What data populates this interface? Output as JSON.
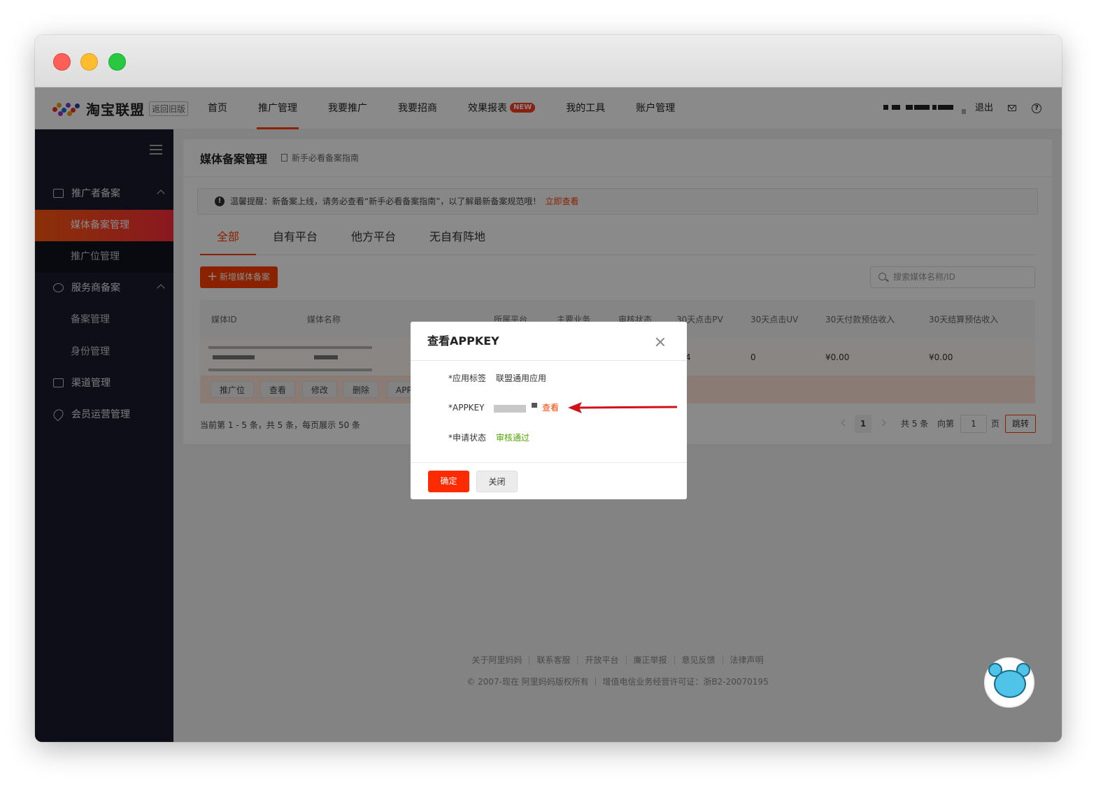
{
  "topnav": {
    "logo_text": "淘宝联盟",
    "old_version": "返回旧版",
    "items": [
      {
        "label": "首页"
      },
      {
        "label": "推广管理"
      },
      {
        "label": "我要推广"
      },
      {
        "label": "我要招商"
      },
      {
        "label": "效果报表",
        "badge": "NEW"
      },
      {
        "label": "我的工具"
      },
      {
        "label": "账户管理"
      }
    ],
    "logout": "退出",
    "help": "?"
  },
  "sidebar": {
    "groups": [
      {
        "label": "推广者备案"
      },
      {
        "label": "服务商备案"
      },
      {
        "label": "渠道管理"
      },
      {
        "label": "会员运营管理"
      }
    ],
    "items": [
      {
        "label": "媒体备案管理"
      },
      {
        "label": "推广位管理"
      },
      {
        "label": "备案管理"
      },
      {
        "label": "身份管理"
      }
    ]
  },
  "page": {
    "title": "媒体备案管理",
    "guide": "新手必看备案指南",
    "notice": "温馨提醒：新备案上线，请务必查看“新手必看备案指南”，以了解最新备案规范哦！",
    "notice_link": "立即查看",
    "notice_icon": "!",
    "tabs": [
      {
        "label": "全部"
      },
      {
        "label": "自有平台"
      },
      {
        "label": "他方平台"
      },
      {
        "label": "无自有阵地"
      }
    ],
    "add_button": "新增媒体备案",
    "add_icon": "+",
    "search_placeholder": "搜索媒体名称/ID"
  },
  "table": {
    "columns": [
      "媒体ID",
      "媒体名称",
      "所属平台",
      "主要业务",
      "审核状态",
      "30天点击PV",
      "30天点击UV",
      "30天付款预估收入",
      "30天结算预估收入"
    ],
    "row": {
      "pv": "4",
      "uv": "0",
      "pay_income": "¥0.00",
      "settle_income": "¥0.00"
    },
    "actions": [
      "推广位",
      "查看",
      "修改",
      "删除",
      "APP"
    ]
  },
  "pager": {
    "info": "当前第 1 - 5 条，共 5 条，每页展示 50 条",
    "current": "1",
    "total": "共 5 条",
    "goto_prefix": "向第",
    "goto_value": "1",
    "goto_suffix": "页",
    "jump": "跳转"
  },
  "footer": {
    "links": [
      "关于阿里妈妈",
      "联系客服",
      "开放平台",
      "廉正举报",
      "意见反馈",
      "法律声明"
    ],
    "copyright": "© 2007-现在 阿里妈妈版权所有 ｜ 增值电信业务经营许可证：浙B2-20070195"
  },
  "modal": {
    "title": "查看APPKEY",
    "rows": [
      {
        "label": "*应用标签",
        "value": "联盟通用应用"
      },
      {
        "label": "*APPKEY",
        "value": "查看"
      },
      {
        "label": "*申请状态",
        "value": "审核通过"
      }
    ],
    "ok": "确定",
    "close": "关闭"
  },
  "colors": {
    "accent": "#ff4000",
    "sidebar_bg": "#1a1a2e",
    "status_ok": "#52a400",
    "annotation_arrow": "#d0101a"
  }
}
